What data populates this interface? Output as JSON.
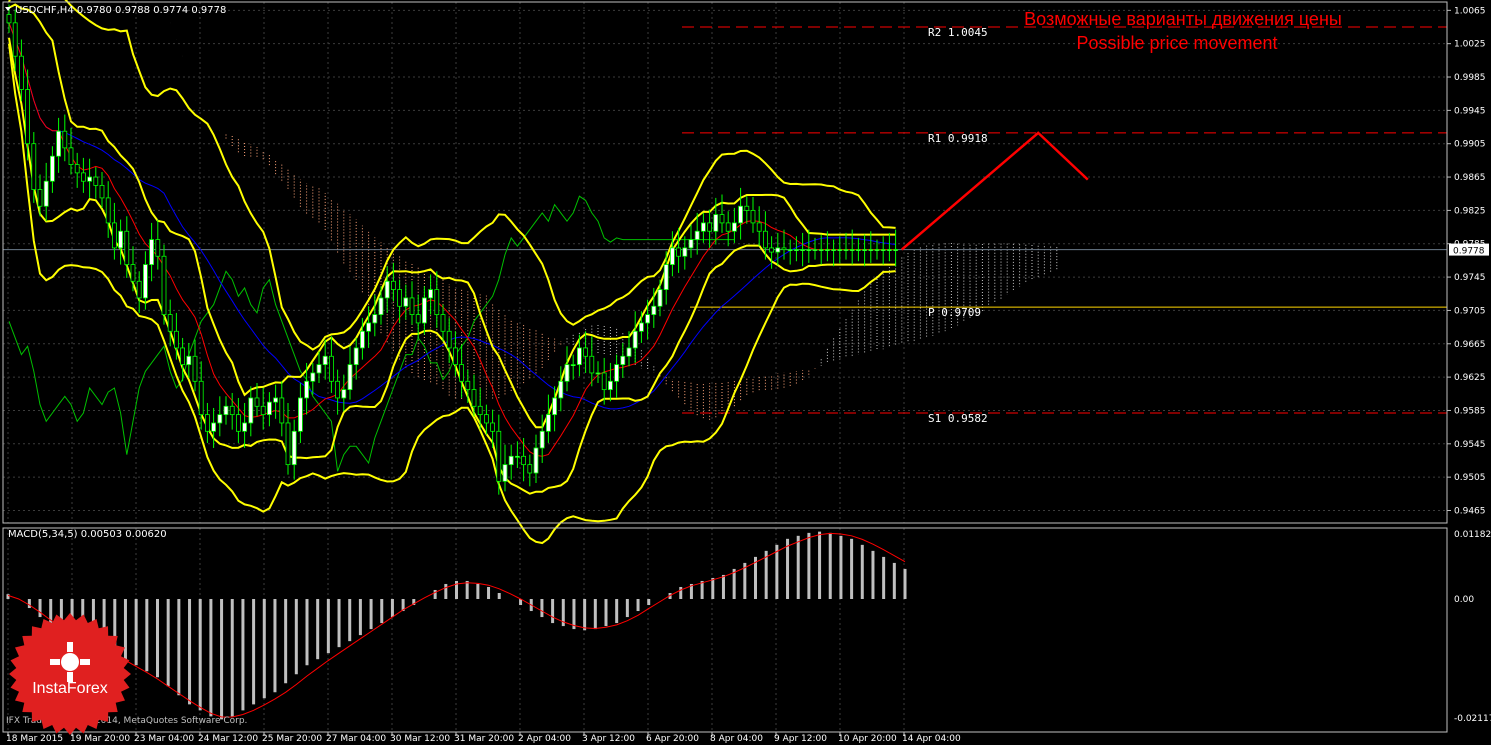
{
  "header": {
    "symbol_line": "USDCHF,H4  0.9780 0.9788 0.9774 0.9778",
    "macd_line": "MACD(5,34,5) 0.00503 0.00620",
    "annotation_ru": "Возможные варианты движения цены",
    "annotation_en": "Possible price movement",
    "copyright": "IFX Trader, © 2001-2014, MetaQuotes Software Corp.",
    "logo_text": "InstaForex"
  },
  "colors": {
    "background": "#000000",
    "grid": "#3c3c3c",
    "frame": "#c0c0c0",
    "bollinger": "#ffff00",
    "bull_candle": "#ffffff",
    "bear_candle": "#000000",
    "candle_wick": "#00ff00",
    "ichimoku_tenkan": "#ff0000",
    "ichimoku_kijun": "#0000ff",
    "ichimoku_chikou": "#00c000",
    "kumo_bear": "#ffa57a",
    "kumo_bull": "#c8c8c8",
    "forecast": "#ff0000",
    "levels": "#ff0000",
    "pivot": "#ffd700",
    "macd_hist": "#c0c0c0",
    "macd_signal": "#ff0000",
    "logo": "#e02020"
  },
  "chart_data": {
    "type": "line",
    "instrument": "USDCHF",
    "timeframe": "H4",
    "price_axis": {
      "ylim": [
        0.945,
        1.0075
      ],
      "tick_labels": [
        "1.0065",
        "1.0025",
        "0.9985",
        "0.9945",
        "0.9905",
        "0.9865",
        "0.9825",
        "0.9785",
        "0.9745",
        "0.9705",
        "0.9665",
        "0.9625",
        "0.9585",
        "0.9545",
        "0.9505",
        "0.9465"
      ],
      "current_price": "0.9778"
    },
    "time_axis": {
      "tick_labels": [
        "18 Mar 2015",
        "19 Mar 20:00",
        "23 Mar 04:00",
        "24 Mar 12:00",
        "25 Mar 20:00",
        "27 Mar 04:00",
        "30 Mar 12:00",
        "31 Mar 20:00",
        "2 Apr 04:00",
        "3 Apr 12:00",
        "6 Apr 20:00",
        "8 Apr 04:00",
        "9 Apr 12:00",
        "10 Apr 20:00",
        "14 Apr 04:00"
      ],
      "bar_count": 144,
      "forecast_bars": 30
    },
    "levels": [
      {
        "label": "R2 1.0045",
        "value": 1.0045
      },
      {
        "label": "R1 0.9918",
        "value": 0.9918
      },
      {
        "label": "P 0.9709",
        "value": 0.9709
      },
      {
        "label": "S1 0.9582",
        "value": 0.9582
      }
    ],
    "forecast_path": [
      {
        "bar": 144,
        "value": 0.9778
      },
      {
        "bar": 166,
        "value": 0.9918
      },
      {
        "bar": 174,
        "value": 0.9862
      }
    ],
    "price_close": [
      1.005,
      1.001,
      0.997,
      0.9905,
      0.985,
      0.983,
      0.986,
      0.989,
      0.992,
      0.99,
      0.988,
      0.987,
      0.986,
      0.9865,
      0.9855,
      0.984,
      0.981,
      0.978,
      0.98,
      0.976,
      0.974,
      0.972,
      0.976,
      0.979,
      0.977,
      0.97,
      0.968,
      0.966,
      0.964,
      0.965,
      0.962,
      0.958,
      0.956,
      0.957,
      0.958,
      0.959,
      0.958,
      0.956,
      0.957,
      0.96,
      0.959,
      0.958,
      0.9595,
      0.96,
      0.957,
      0.952,
      0.956,
      0.96,
      0.962,
      0.963,
      0.964,
      0.965,
      0.962,
      0.96,
      0.961,
      0.964,
      0.966,
      0.968,
      0.969,
      0.97,
      0.972,
      0.974,
      0.973,
      0.971,
      0.972,
      0.97,
      0.969,
      0.972,
      0.973,
      0.97,
      0.968,
      0.966,
      0.964,
      0.962,
      0.961,
      0.959,
      0.958,
      0.957,
      0.956,
      0.95,
      0.952,
      0.953,
      0.953,
      0.952,
      0.951,
      0.954,
      0.956,
      0.958,
      0.96,
      0.962,
      0.964,
      0.964,
      0.966,
      0.965,
      0.963,
      0.963,
      0.961,
      0.962,
      0.964,
      0.965,
      0.966,
      0.968,
      0.969,
      0.97,
      0.971,
      0.973,
      0.976,
      0.978,
      0.977,
      0.978,
      0.979,
      0.98,
      0.981,
      0.98,
      0.982,
      0.981,
      0.98,
      0.981,
      0.983,
      0.9825,
      0.981,
      0.98,
      0.978,
      0.9775,
      0.978,
      0.9778,
      0.9778,
      0.9778,
      0.9778,
      0.9778,
      0.9778,
      0.9778,
      0.9778,
      0.9778,
      0.9778,
      0.9778,
      0.9778,
      0.9778,
      0.9778,
      0.9778,
      0.9778,
      0.9778,
      0.9778,
      0.9778
    ],
    "macd_axis": {
      "ylim": [
        -0.0221,
        0.0118
      ],
      "tick_labels": [
        "0.01182",
        "0.00",
        "-0.02117"
      ]
    },
    "macd_histogram": [
      0.0008,
      0.0,
      -0.0015,
      -0.003,
      -0.0045,
      -0.0055,
      -0.006,
      -0.0065,
      -0.0075,
      -0.0085,
      -0.009,
      -0.01,
      -0.011,
      -0.012,
      -0.013,
      -0.0145,
      -0.016,
      -0.0175,
      -0.0185,
      -0.0195,
      -0.02,
      -0.0195,
      -0.0185,
      -0.0175,
      -0.0165,
      -0.0155,
      -0.014,
      -0.0125,
      -0.011,
      -0.01,
      -0.009,
      -0.008,
      -0.007,
      -0.006,
      -0.005,
      -0.004,
      -0.003,
      -0.002,
      -0.001,
      0.0,
      0.0015,
      0.0025,
      0.003,
      0.003,
      0.0025,
      0.002,
      0.001,
      0.0,
      -0.001,
      -0.002,
      -0.003,
      -0.004,
      -0.0045,
      -0.005,
      -0.0052,
      -0.005,
      -0.0045,
      -0.004,
      -0.003,
      -0.002,
      -0.001,
      0.0,
      0.001,
      0.002,
      0.0025,
      0.003,
      0.0035,
      0.004,
      0.005,
      0.006,
      0.007,
      0.008,
      0.009,
      0.01,
      0.0105,
      0.011,
      0.0112,
      0.011,
      0.0105,
      0.01,
      0.009,
      0.008,
      0.007,
      0.006,
      0.005
    ],
    "macd_signal": [
      0.0006,
      0.0,
      -0.001,
      -0.0022,
      -0.0035,
      -0.0048,
      -0.006,
      -0.007,
      -0.0078,
      -0.0086,
      -0.0094,
      -0.0102,
      -0.0112,
      -0.0122,
      -0.0133,
      -0.0145,
      -0.0157,
      -0.0169,
      -0.018,
      -0.019,
      -0.0196,
      -0.0196,
      -0.0192,
      -0.0185,
      -0.0176,
      -0.0166,
      -0.0155,
      -0.0142,
      -0.0128,
      -0.0115,
      -0.0102,
      -0.009,
      -0.0078,
      -0.0066,
      -0.0054,
      -0.0042,
      -0.003,
      -0.0018,
      -0.0008,
      0.0002,
      0.0011,
      0.0019,
      0.0025,
      0.0027,
      0.0026,
      0.0023,
      0.0017,
      0.0009,
      0.0,
      -0.001,
      -0.002,
      -0.003,
      -0.0038,
      -0.0044,
      -0.0048,
      -0.0049,
      -0.0047,
      -0.0043,
      -0.0036,
      -0.0027,
      -0.0016,
      -0.0005,
      0.0006,
      0.0015,
      0.0022,
      0.0027,
      0.0032,
      0.0037,
      0.0044,
      0.0052,
      0.0061,
      0.007,
      0.0079,
      0.0088,
      0.0095,
      0.0102,
      0.0107,
      0.0109,
      0.0108,
      0.0105,
      0.0099,
      0.0091,
      0.0082,
      0.0072,
      0.0062
    ]
  }
}
